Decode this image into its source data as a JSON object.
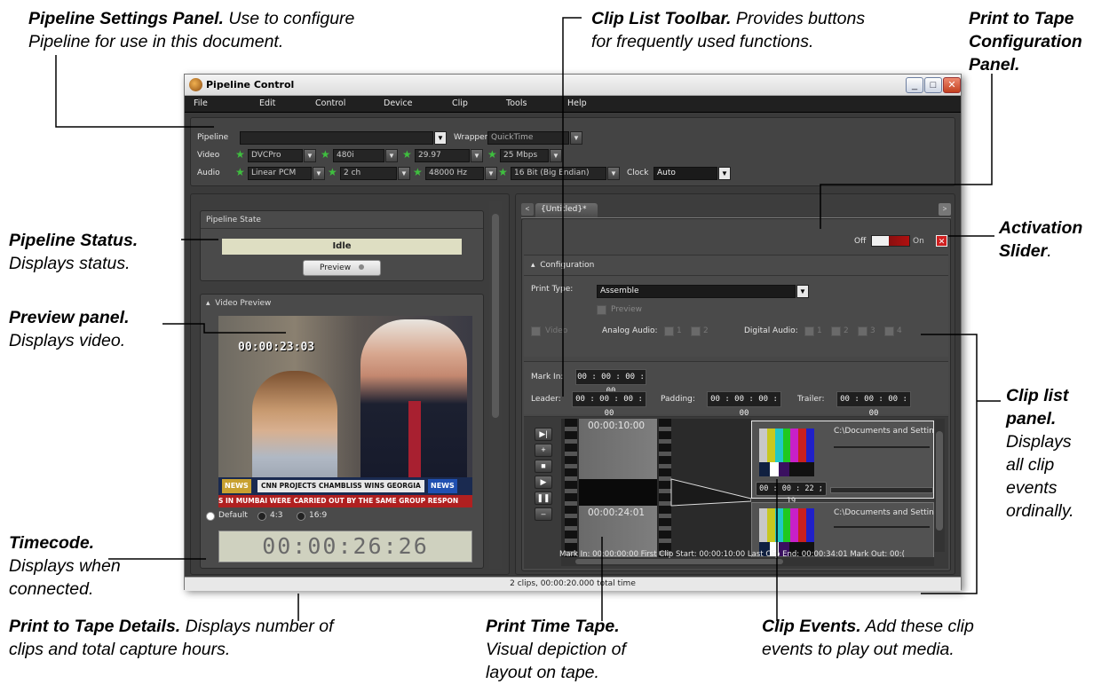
{
  "callouts": {
    "pipeline_settings": {
      "bold": "Pipeline Settings Panel.",
      "rest": " Use to configure",
      "line2": "Pipeline for use in this document."
    },
    "clip_toolbar": {
      "bold": "Clip List Toolbar.",
      "rest": " Provides buttons",
      "line2": "for frequently used functions."
    },
    "ptt_config": {
      "line1": "Print to Tape",
      "line2": "Configuration",
      "line3": "Panel."
    },
    "pipeline_status": {
      "bold": "Pipeline Status.",
      "line2": "Displays status."
    },
    "activation": {
      "bold": "Activation",
      "line2_bold": "Slider",
      "line2_tail": "."
    },
    "preview_panel": {
      "bold": "Preview panel.",
      "line2": "Displays video."
    },
    "clip_list": {
      "line1": "Clip list",
      "line2": "panel.",
      "line3": "Displays",
      "line4": "all clip",
      "line5": "events",
      "line6": "ordinally."
    },
    "timecode": {
      "bold": "Timecode.",
      "line2": "Displays when",
      "line3": "connected."
    },
    "ptt_details": {
      "bold": "Print to Tape Details.",
      "rest": " Displays number of",
      "line2": "clips and total capture hours."
    },
    "print_time_tape": {
      "bold": "Print Time Tape.",
      "line2": "Visual depiction of",
      "line3": "layout on tape."
    },
    "clip_events": {
      "bold": "Clip Events.",
      "rest": " Add these clip",
      "line2": "events to play out media."
    }
  },
  "window": {
    "title": "Pipeline Control",
    "menu": [
      "File",
      "Edit",
      "Control",
      "Device",
      "Clip",
      "Tools",
      "Help"
    ]
  },
  "settings": {
    "pipeline_label": "Pipeline",
    "pipeline_value": "",
    "wrapper_label": "Wrapper",
    "wrapper_value": "QuickTime",
    "video_label": "Video",
    "video": [
      "DVCPro",
      "480i",
      "29.97",
      "25 Mbps"
    ],
    "audio_label": "Audio",
    "audio": [
      "Linear PCM",
      "2  ch",
      "48000  Hz",
      "16 Bit (Big Endian)"
    ],
    "clock_label": "Clock",
    "clock_value": "Auto"
  },
  "left": {
    "state_title": "Pipeline State",
    "state_value": "Idle",
    "preview_btn": "Preview",
    "video_preview_title": "Video Preview",
    "overlay_tc": "00:00:23:03",
    "ticker_left": "NEWS",
    "ticker_main": "CNN PROJECTS CHAMBLISS WINS GEORGIA",
    "ticker_right": "NEWS",
    "crawl": "S IN MUMBAI WERE CARRIED OUT BY THE SAME GROUP RESPON",
    "aspect": [
      "Default",
      "4:3",
      "16:9"
    ],
    "timecode": "00:00:26:26"
  },
  "right": {
    "tab": "{Untitled}*",
    "off": "Off",
    "on": "On",
    "config_title": "Configuration",
    "print_type_label": "Print Type:",
    "print_type_value": "Assemble",
    "preview_label": "Preview",
    "video_label": "Video",
    "analog_label": "Analog Audio:",
    "analog": [
      "1",
      "2"
    ],
    "digital_label": "Digital Audio:",
    "digital": [
      "1",
      "2",
      "3",
      "4"
    ],
    "mark_in_label": "Mark In:",
    "mark_in": "00 : 00 : 00 : 00",
    "leader_label": "Leader:",
    "leader": "00 : 00 : 00 : 00",
    "padding_label": "Padding:",
    "padding": "00 : 00 : 00 : 00",
    "trailer_label": "Trailer:",
    "trailer": "00 : 00 : 00 : 00",
    "tape_tc1": "00:00:10:00",
    "tape_tc2": "00:00:24:01",
    "clip1_path": "C:\\Documents and Settin",
    "clip1_tc": "00 : 00 : 22 ; 19",
    "clip2_path": "C:\\Documents and Settin",
    "summary": "Mark In: 00:00:00:00   First Clip Start: 00:00:10:00   Last Clip End: 00:00:34:01   Mark Out: 00:("
  },
  "status": "2 clips, 00:00:20.000 total time",
  "colors": {
    "bars": [
      "#c8c8c8",
      "#c8c820",
      "#20c8c8",
      "#20c820",
      "#c820c8",
      "#c82020",
      "#2020c8"
    ]
  }
}
